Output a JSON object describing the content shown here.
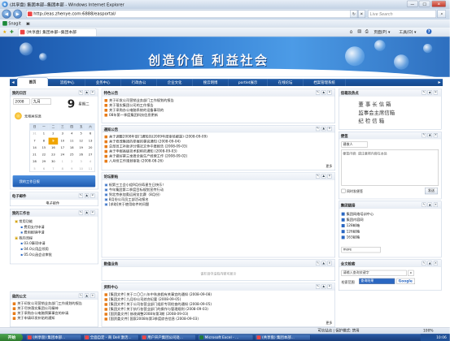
{
  "window": {
    "title": "(共享盘) 集团本部--集团本部 - Windows Internet Explorer",
    "min": "—",
    "max": "□",
    "close": "✕"
  },
  "addressbar": {
    "url": "http://eas.zhenye.com:6888/easportal/",
    "refresh": "↻",
    "stop": "✕",
    "search_placeholder": "Live Search",
    "search_icon": "magnifier"
  },
  "commandbar": {
    "snagit": "Snagit",
    "camera": "▣"
  },
  "favbar": {
    "tab_label": "(共享盘) 集团本部--集团本部",
    "home": "⌂",
    "feeds": "▤",
    "print": "⎙",
    "page_menu": "页面(P) ▾",
    "tools_menu": "工具(O) ▾",
    "help": "?"
  },
  "banner": {
    "slogan": "创造价值  利益社会"
  },
  "nav": {
    "items": [
      "首页",
      "流程中心",
      "业务中心",
      "行政办公",
      "企业文化",
      "搜云明博",
      "portlet展示",
      "在线论坛",
      "档案管理系统"
    ],
    "left_arrow": "◀",
    "right_arrow": "▶"
  },
  "panels": {
    "calendar": {
      "title": "我的日历",
      "year": "2008",
      "month": "九月",
      "weekday": "星期二",
      "day_label": "无相关信息",
      "weeknames": [
        "日",
        "一",
        "二",
        "三",
        "四",
        "五",
        "六"
      ],
      "days": [
        "31",
        "1",
        "2",
        "3",
        "4",
        "5",
        "6",
        "7",
        "8",
        "9",
        "10",
        "11",
        "12",
        "13",
        "14",
        "15",
        "16",
        "17",
        "18",
        "19",
        "20",
        "21",
        "22",
        "23",
        "24",
        "25",
        "26",
        "27",
        "28",
        "29",
        "30",
        "1",
        "2",
        "3",
        "4",
        "5",
        "6",
        "7",
        "8",
        "9",
        "10",
        "11"
      ],
      "today": "9",
      "day_big": "9",
      "footer": "我的工作日报"
    },
    "mail": {
      "title": "电子邮件",
      "body": "电子邮件"
    },
    "workbench": {
      "title": "我的工作台",
      "tree": [
        "常用功能",
        "费用支付申请",
        "费用报销申请",
        "我的流程",
        "03.0事项申请",
        "04.0公用品领用",
        "05.0公函会议审批"
      ]
    },
    "mydocs": {
      "title": "我的公文",
      "items": [
        "关于印发公司营销业务部门工作规划的报告",
        "关于尽快落实集团公司精神",
        "关于采购办公电脑预算事宜的申请",
        "关于申请印发补贴的通知"
      ]
    },
    "notice": {
      "title": "特色公告",
      "items": [
        "关于印发公司营销业务部门工作规划的报告",
        "关于落实集团公司的工作报告",
        "关于采购办公电脑系统的设备事项的",
        "08年第一季度集团科技信息更新"
      ]
    },
    "bulletin": {
      "title": "通知公告",
      "items": [
        "关于调整2008年部门通知的(2009年度审核都是)  (2008-09-09)",
        "关于修改集团的参展的事宜通知  (2008-09-04)",
        "总部员工补助评分情况文件中度报告  (2008-09-03)",
        "关于申报高级技术职称的通知  (2008-09-03)",
        "关于做好第三季度全面生产经营工作  (2008-09-02)",
        "八月份工作规划审批  (2008-08-26)"
      ],
      "more": "更多"
    },
    "forum": {
      "title": "论坛新帖",
      "items": [
        "祝第三工会小组9月份寿星生日快乐！",
        "今年集团第二季度目标规划宣传行动",
        "到北京参加奥运阅览比赛（8月份）",
        "8月份公司员工部活动报名",
        "[求助]关于使用软件的问题"
      ]
    },
    "bizflow": {
      "title": "数值业务",
      "empty": "该栏目中没有内容可显示"
    },
    "resources": {
      "title": "资料中心",
      "items": [
        "[集团文件] 关于二〇〇八年中秋放假有关事宜的通知  (2008-09-08)",
        "[集团文件] 九月份公司综合纪要  (2008-09-05)",
        "[集团文件] 关于公司各营业部门组织专项检查的通知  (2008-09-05)",
        "[集团文件] 关于执行各营业部门的操作与管理规则  (2008-09-03)",
        "[国资委文件] 修改调整2008年第3期  (2008-09-03)",
        "[国资委文件] 国家2008年第3季度综合信息  (2008-09-03)"
      ],
      "more": "更多"
    },
    "hotspot": {
      "title": "信箱及热点",
      "lines": [
        "董 事 长 信 箱",
        "监事会主席信箱",
        "纪 检 信 箱"
      ]
    },
    "quickpost": {
      "title": "便签",
      "select": "建收人",
      "hint": "便签内容: 请注意将内容在本处",
      "check": "同时发便签",
      "send": "发送"
    },
    "quicklinks": {
      "title": "集团链接",
      "items": [
        "集团网络培训中心",
        "集团内容网",
        "128邮箱",
        "126邮箱",
        "163邮箱"
      ],
      "select_default": "more"
    },
    "fulltext": {
      "title": "全文检索",
      "placeholder": "请输入查询关键字",
      "scope_label": "检索范围",
      "scope_value": "查询结果",
      "engine": "Google"
    }
  },
  "status": {
    "zone": "可信站点 | 保护模式: 禁用",
    "zoom": "100%"
  },
  "taskbar": {
    "start": "开始",
    "items": [
      "(共享盘) 集团本部...",
      "全面自定 - 商 Dell 激活...",
      "用户开户集团公司处...",
      "Microsoft Excel - ...",
      "(共享盘) 集团本部..."
    ],
    "clock": "10:06"
  }
}
